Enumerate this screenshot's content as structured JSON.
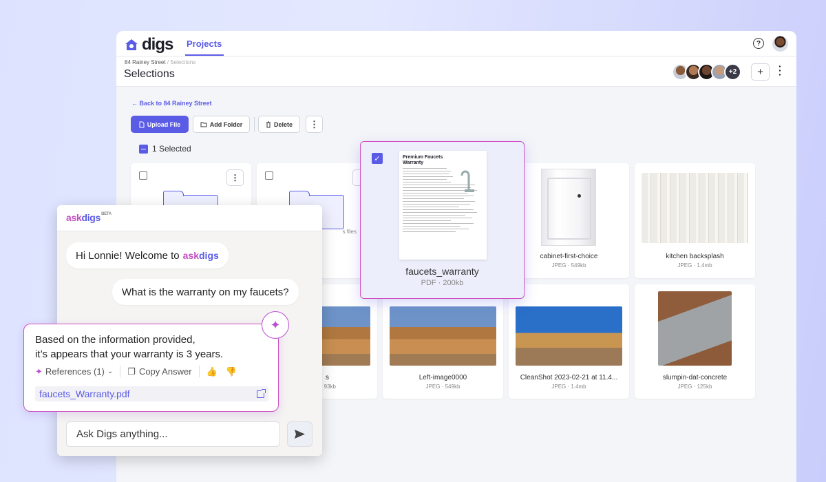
{
  "app": {
    "logo": "digs",
    "nav_tab": "Projects"
  },
  "header": {
    "breadcrumb_parent": "84 Rainey Street",
    "breadcrumb_sep": "/",
    "breadcrumb_current": "Selections",
    "title": "Selections",
    "avatars_more": "+2",
    "add_label": "+"
  },
  "toolbar": {
    "back_label": "← Back to 84 Rainey Street",
    "upload_label": "Upload File",
    "add_folder_label": "Add Folder",
    "delete_label": "Delete",
    "more_label": "⋮"
  },
  "selection": {
    "label": "1 Selected"
  },
  "files": [
    {
      "name": "",
      "meta": ""
    },
    {
      "name": "",
      "meta": "s files"
    },
    {
      "name": "cabinet-first-choice",
      "meta": "JPEG · 549kb"
    },
    {
      "name": "kitchen backsplash",
      "meta": "JPEG · 1.4mb"
    },
    {
      "name": "s",
      "meta": "93kb"
    },
    {
      "name": "Left-image0000",
      "meta": "JPEG · 549kb"
    },
    {
      "name": "CleanShot 2023-02-21 at 11.4...",
      "meta": "JPEG · 1.4mb"
    },
    {
      "name": "slumpin-dat-concrete",
      "meta": "JPEG · 125kb"
    }
  ],
  "selected_file": {
    "name": "faucets_warranty",
    "meta": "PDF · 200kb",
    "doc_title": "Premium Faucets Warranty"
  },
  "chat": {
    "brand_a": "ask",
    "brand_b": "digs",
    "beta": "BETA",
    "greeting": "Hi Lonnie! Welcome to",
    "user_question": "What is the warranty on my faucets?",
    "answer_line1": "Based on the information provided,",
    "answer_line2": "it’s appears that your warranty is 3 years.",
    "references_label": "References (1)",
    "copy_label": "Copy Answer",
    "file_link": "faucets_Warranty.pdf",
    "input_placeholder": "Ask Digs anything..."
  },
  "colors": {
    "accent": "#5b5ce6",
    "highlight": "#cc4fc0"
  }
}
